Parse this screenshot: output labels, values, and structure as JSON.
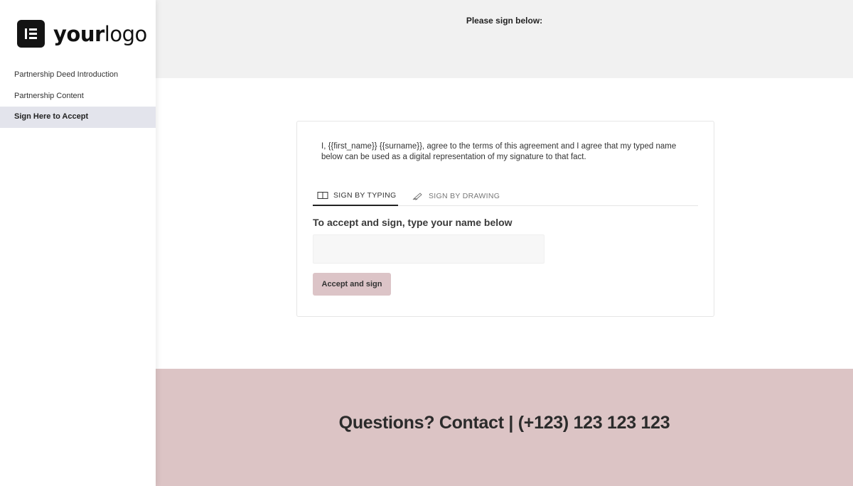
{
  "brand": {
    "logo_bold": "your",
    "logo_light": "logo"
  },
  "sidebar": {
    "items": [
      {
        "label": "Partnership Deed Introduction"
      },
      {
        "label": "Partnership Content"
      },
      {
        "label": "Sign Here to Accept",
        "active": true
      }
    ]
  },
  "header": {
    "prompt": "Please sign below:"
  },
  "signature": {
    "agreement_text": "I, {{first_name}} {{surname}}, agree to the terms of this agreement and I agree that my typed name below can be used as a digital representation of my signature to that fact.",
    "tabs": [
      {
        "label": "SIGN BY TYPING",
        "icon": "keyboard-icon",
        "active": true
      },
      {
        "label": "SIGN BY DRAWING",
        "icon": "pen-icon",
        "active": false
      }
    ],
    "instruction": "To accept and sign, type your name below",
    "name_value": "",
    "accept_label": "Accept and sign"
  },
  "footer": {
    "contact": "Questions? Contact | (+123) 123 123 123"
  },
  "colors": {
    "accent": "#dcc4c7",
    "footer_bg": "#dcc4c5",
    "active_nav": "#e3e4ec",
    "top_band": "#f1f1f1"
  }
}
